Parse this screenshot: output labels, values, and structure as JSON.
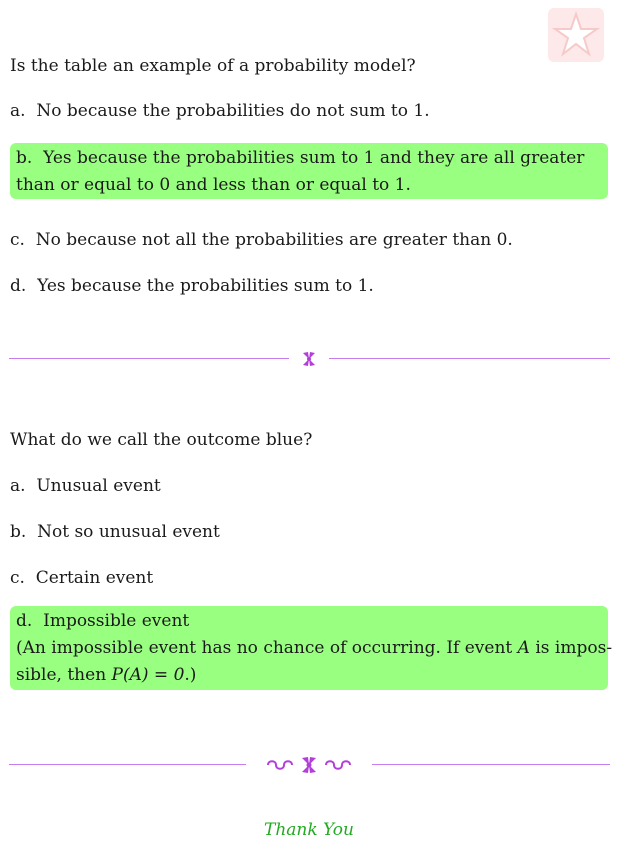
{
  "logo": {
    "icon": "star-logo-icon",
    "color": "#f5b8b8"
  },
  "colors": {
    "highlight": "#99ff80",
    "divider": "#c77df0",
    "thanks": "#22aa22"
  },
  "question1": {
    "prompt": "Is the table an example of a probability model?",
    "options": [
      {
        "label": "a.",
        "text": "No because the probabilities do not sum to 1."
      },
      {
        "label": "b.",
        "text_line1": "Yes because the probabilities sum to 1 and they are all greater",
        "text_line2": "than or equal to 0 and less than or equal to 1.",
        "correct": true
      },
      {
        "label": "c.",
        "text": "No because not all the probabilities are greater than 0."
      },
      {
        "label": "d.",
        "text": "Yes because the probabilities sum to 1."
      }
    ]
  },
  "question2": {
    "prompt": "What do we call the outcome blue?",
    "options": [
      {
        "label": "a.",
        "text": "Unusual event"
      },
      {
        "label": "b.",
        "text": "Not so unusual event"
      },
      {
        "label": "c.",
        "text": "Certain event"
      },
      {
        "label": "d.",
        "text": "Impossible event",
        "correct": true,
        "explanation_line1_a": "(An impossible event has no chance of occurring. If event ",
        "explanation_var": "A",
        "explanation_line1_b": " is impos-",
        "explanation_line2_a": "sible, then ",
        "explanation_formula": "P(A) = 0",
        "explanation_line2_b": ".)"
      }
    ]
  },
  "footer": {
    "thanks": "Thank You"
  }
}
